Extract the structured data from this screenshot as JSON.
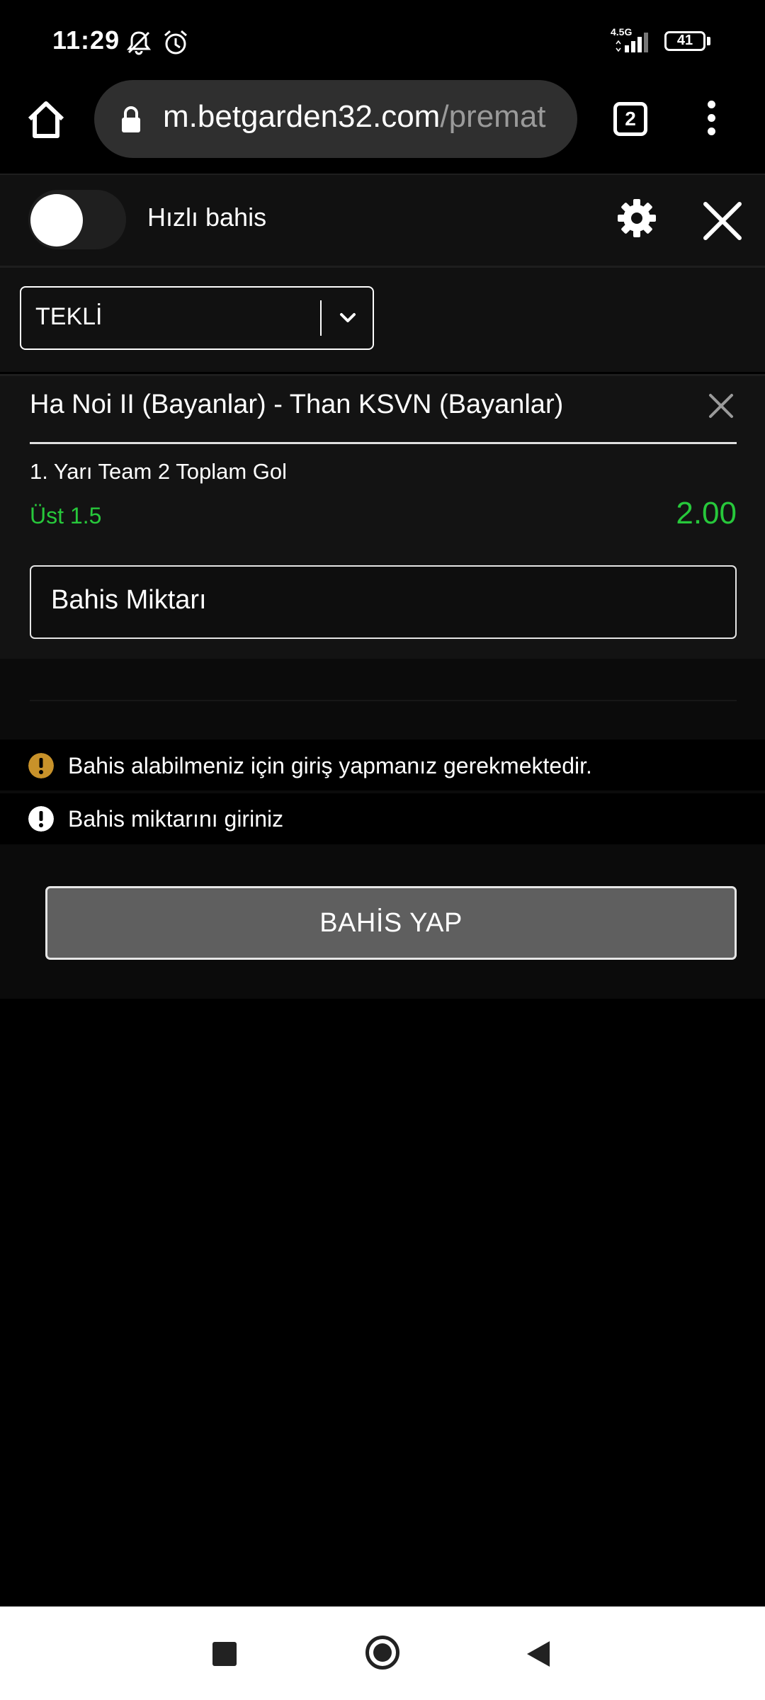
{
  "status_bar": {
    "time": "11:29",
    "network": "4.5G",
    "battery": "41"
  },
  "browser": {
    "url_host": "m.betgarden32.com",
    "url_path": "/premat",
    "tab_count": "2"
  },
  "quick_bet": {
    "label": "Hızlı bahis",
    "enabled": false
  },
  "bet_type": {
    "selected": "TEKLİ"
  },
  "bet_item": {
    "match": "Ha Noi II (Bayanlar) - Than KSVN (Bayanlar)",
    "market": "1. Yarı Team 2 Toplam Gol",
    "selection": "Üst 1.5",
    "odds": "2.00",
    "stake_placeholder": "Bahis Miktarı"
  },
  "messages": [
    {
      "text": "Bahis alabilmeniz için giriş yapmanız gerekmektedir.",
      "icon": "warning-icon",
      "color": "#c8922a"
    },
    {
      "text": "Bahis miktarını giriniz",
      "icon": "alert-icon",
      "color": "#ffffff"
    }
  ],
  "actions": {
    "place_bet": "BAHİS YAP"
  },
  "colors": {
    "accent_green": "#27c83b",
    "warning": "#c8922a",
    "button_gray": "#5f5f5f"
  }
}
